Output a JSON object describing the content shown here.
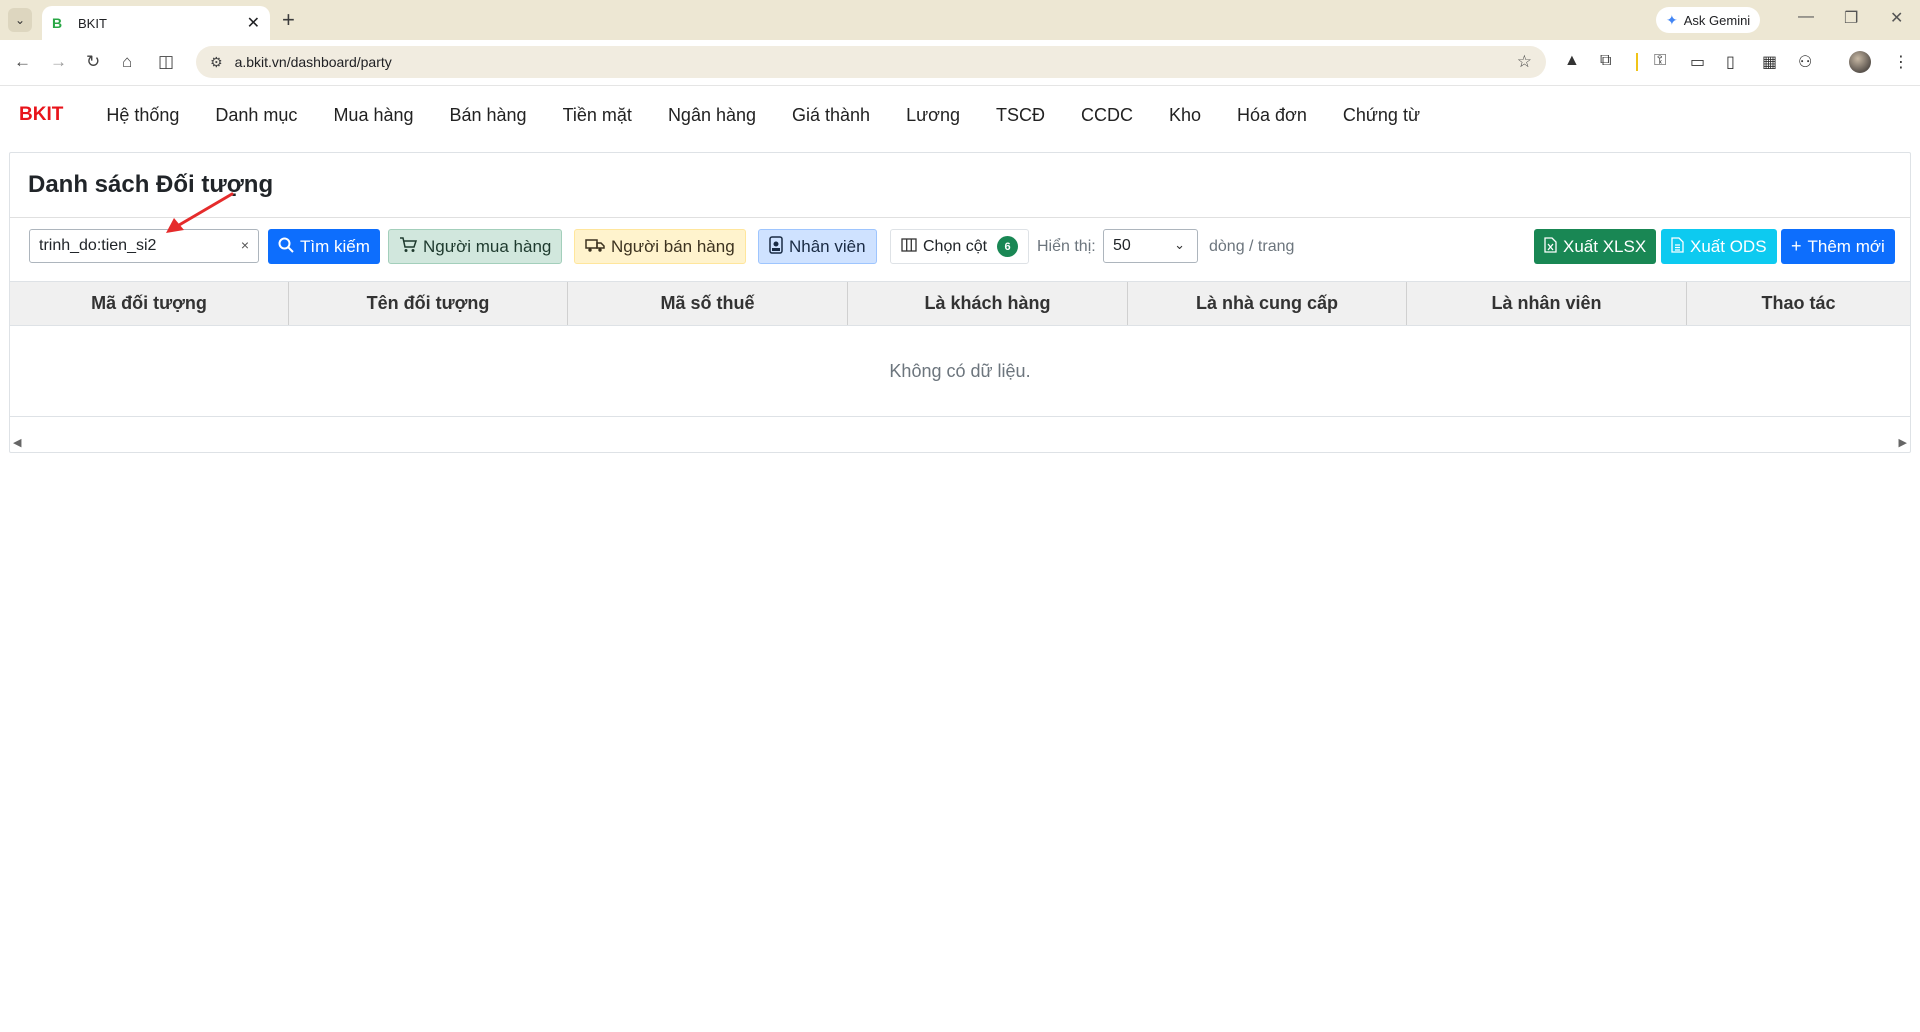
{
  "browser": {
    "tab_favicon": "B",
    "tab_title": "BKIT",
    "url": "a.bkit.vn/dashboard/party",
    "gemini_label": "Ask Gemini"
  },
  "nav": {
    "brand": "BKIT",
    "items": [
      "Hệ thống",
      "Danh mục",
      "Mua hàng",
      "Bán hàng",
      "Tiền mặt",
      "Ngân hàng",
      "Giá thành",
      "Lương",
      "TSCĐ",
      "CCDC",
      "Kho",
      "Hóa đơn",
      "Chứng từ"
    ]
  },
  "page": {
    "title": "Danh sách Đối tượng"
  },
  "controls": {
    "search_value": "trinh_do:tien_si2",
    "clear_glyph": "×",
    "search_btn": "Tìm kiếm",
    "buyer_btn": "Người mua hàng",
    "seller_btn": "Người bán hàng",
    "staff_btn": "Nhân viên",
    "columns_btn": "Chọn cột",
    "columns_count": "6",
    "show_label": "Hiển thị:",
    "page_size": "50",
    "per_page_label": "dòng / trang",
    "xlsx_btn": "Xuất XLSX",
    "ods_btn": "Xuất ODS",
    "add_btn": "Thêm mới"
  },
  "table": {
    "columns": [
      "Mã đối tượng",
      "Tên đối tượng",
      "Mã số thuế",
      "Là khách hàng",
      "Là nhà cung cấp",
      "Là nhân viên",
      "Thao tác"
    ],
    "empty_text": "Không có dữ liệu."
  },
  "colors": {
    "brand": "#e8141b",
    "primary": "#0d6efd",
    "success": "#198754",
    "info": "#0dcaf0",
    "annotation_arrow": "#e52b2b"
  }
}
